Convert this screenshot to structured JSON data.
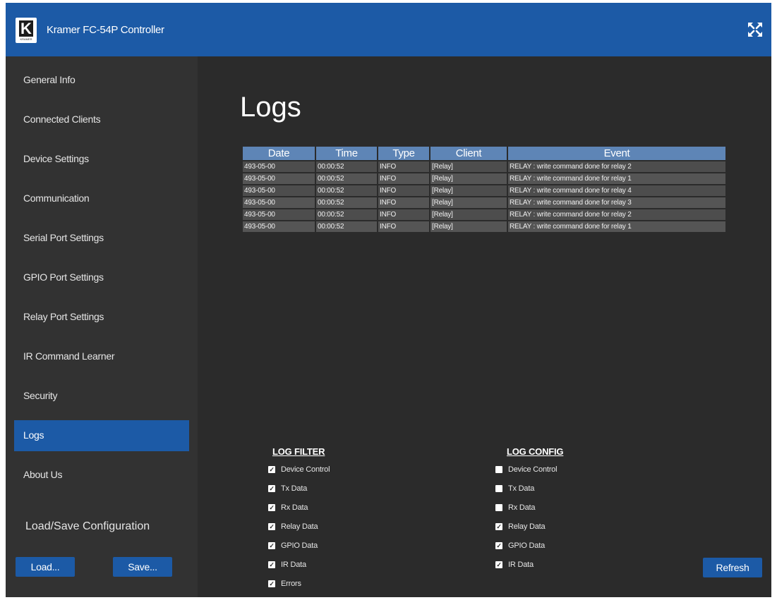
{
  "header": {
    "logo_letter": "K",
    "logo_brand": "KRAMER",
    "title": "Kramer FC-54P Controller",
    "expand_icon": "expand-icon"
  },
  "sidebar": {
    "items": [
      {
        "label": "General Info",
        "active": false
      },
      {
        "label": "Connected Clients",
        "active": false
      },
      {
        "label": "Device Settings",
        "active": false
      },
      {
        "label": "Communication",
        "active": false
      },
      {
        "label": "Serial Port Settings",
        "active": false
      },
      {
        "label": "GPIO Port Settings",
        "active": false
      },
      {
        "label": "Relay Port Settings",
        "active": false
      },
      {
        "label": "IR Command Learner",
        "active": false
      },
      {
        "label": "Security",
        "active": false
      },
      {
        "label": "Logs",
        "active": true
      },
      {
        "label": "About Us",
        "active": false
      }
    ],
    "load_save_title": "Load/Save Configuration",
    "load_label": "Load...",
    "save_label": "Save..."
  },
  "main": {
    "title": "Logs",
    "table": {
      "headers": [
        "Date",
        "Time",
        "Type",
        "Client",
        "Event"
      ],
      "rows": [
        [
          "493-05-00",
          "00:00:52",
          "INFO",
          "[Relay]",
          "RELAY : write command done for relay 2"
        ],
        [
          "493-05-00",
          "00:00:52",
          "INFO",
          "[Relay]",
          "RELAY : write command done for relay 1"
        ],
        [
          "493-05-00",
          "00:00:52",
          "INFO",
          "[Relay]",
          "RELAY : write command done for relay 4"
        ],
        [
          "493-05-00",
          "00:00:52",
          "INFO",
          "[Relay]",
          "RELAY : write command done for relay 3"
        ],
        [
          "493-05-00",
          "00:00:52",
          "INFO",
          "[Relay]",
          "RELAY : write command done for relay 2"
        ],
        [
          "493-05-00",
          "00:00:52",
          "INFO",
          "[Relay]",
          "RELAY : write command done for relay 1"
        ]
      ]
    },
    "log_filter": {
      "title": "LOG FILTER",
      "items": [
        {
          "label": "Device Control",
          "checked": true
        },
        {
          "label": "Tx Data",
          "checked": true
        },
        {
          "label": "Rx Data",
          "checked": true
        },
        {
          "label": "Relay Data",
          "checked": true
        },
        {
          "label": "GPIO Data",
          "checked": true
        },
        {
          "label": "IR Data",
          "checked": true
        },
        {
          "label": "Errors",
          "checked": true
        }
      ]
    },
    "log_config": {
      "title": "LOG CONFIG",
      "items": [
        {
          "label": "Device Control",
          "checked": false
        },
        {
          "label": "Tx Data",
          "checked": false
        },
        {
          "label": "Rx Data",
          "checked": false
        },
        {
          "label": "Relay Data",
          "checked": true
        },
        {
          "label": "GPIO Data",
          "checked": true
        },
        {
          "label": "IR Data",
          "checked": true
        }
      ]
    },
    "refresh_label": "Refresh"
  },
  "colors": {
    "brand_blue": "#1c5aa6",
    "background": "#2b2b2b",
    "sidebar": "#323232",
    "table_header": "#5e85b6"
  }
}
